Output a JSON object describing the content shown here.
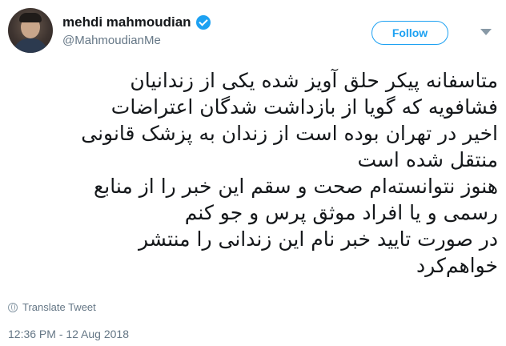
{
  "user": {
    "display_name": "mehdi mahmoudian",
    "handle": "@MahmoudianMe",
    "verified": true
  },
  "actions": {
    "follow_label": "Follow"
  },
  "tweet": {
    "lines": [
      "متاسفانه پیکر حلق آویز شده یکی از زندانیان",
      "فشافویه که گویا از بازداشت شدگان اعتراضات",
      "اخیر در تهران بوده است از زندان به پزشک قانونی",
      "منتقل شده است",
      "هنوز نتوانسته‌ام صحت و سقم این خبر را از منابع",
      "رسمی و یا افراد موثق پرس و جو کنم",
      "در صورت تایید خبر نام این زندانی را منتشر",
      "خواهم‌کرد"
    ],
    "translate_label": "Translate Tweet",
    "timestamp": "12:36 PM - 12 Aug 2018"
  },
  "colors": {
    "accent": "#1da1f2",
    "text": "#14171a",
    "muted": "#657786"
  },
  "icons": {
    "verified": "verified-badge-icon",
    "menu": "chevron-down-icon",
    "translate": "globe-icon"
  }
}
